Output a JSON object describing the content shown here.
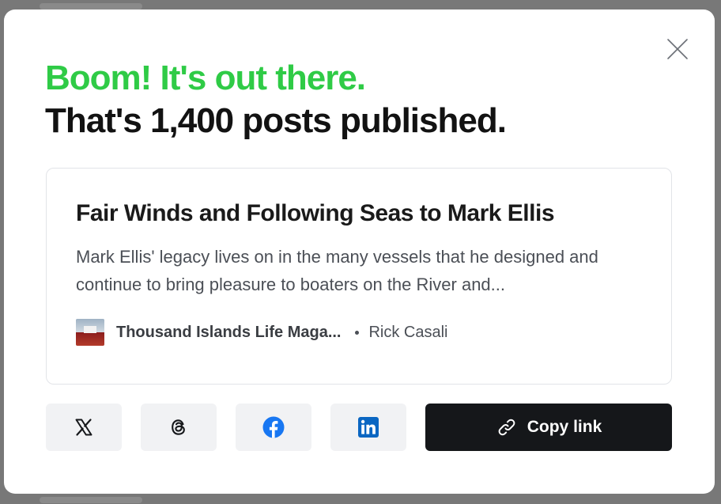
{
  "modal": {
    "headline_line1": "Boom! It's out there.",
    "headline_line2": "That's 1,400 posts published.",
    "close_icon": "close-icon"
  },
  "post": {
    "title": "Fair Winds and Following Seas to Mark Ellis",
    "excerpt": "Mark Ellis' legacy lives on in the many vessels that he designed and continue to bring pleasure to boaters on the River and...",
    "publication": "Thousand Islands Life Maga...",
    "author": "Rick Casali"
  },
  "share": {
    "buttons": [
      {
        "icon": "x-icon",
        "color": "#15171a"
      },
      {
        "icon": "threads-icon",
        "color": "#15171a"
      },
      {
        "icon": "facebook-icon",
        "color": "#1877f2"
      },
      {
        "icon": "linkedin-icon",
        "color": "#0a66c2"
      }
    ],
    "copy_label": "Copy link",
    "copy_icon": "link-icon"
  },
  "colors": {
    "accent_green": "#2fcb46",
    "dark": "#15171a",
    "button_bg": "#f1f2f4"
  }
}
